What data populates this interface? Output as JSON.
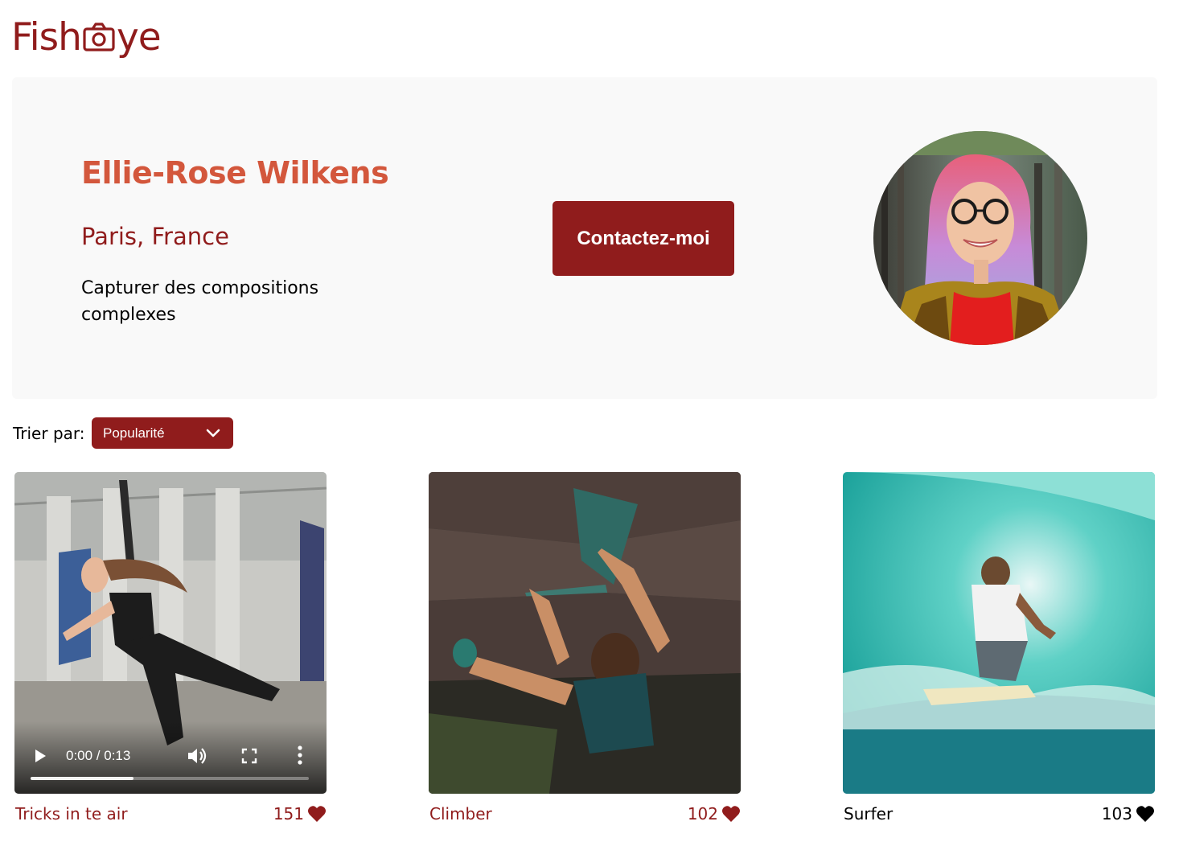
{
  "logo": {
    "text_before": "Fish",
    "text_after": "ye"
  },
  "photographer": {
    "name": "Ellie-Rose Wilkens",
    "location": "Paris, France",
    "tagline": "Capturer des compositions complexes"
  },
  "contact_button": {
    "label": "Contactez-moi"
  },
  "sort": {
    "label": "Trier par:",
    "selected": "Popularité"
  },
  "gallery": [
    {
      "title": "Tricks in te air",
      "likes": "151",
      "type": "video",
      "video": {
        "time": "0:00 / 0:13",
        "progress": 0.0
      },
      "liked": false
    },
    {
      "title": "Climber",
      "likes": "102",
      "type": "image",
      "liked": false
    },
    {
      "title": "Surfer",
      "likes": "103",
      "type": "image",
      "liked": true
    }
  ],
  "colors": {
    "brand": "#901c1c",
    "name_accent": "#d3573c",
    "header_bg": "#f9f9f9"
  }
}
